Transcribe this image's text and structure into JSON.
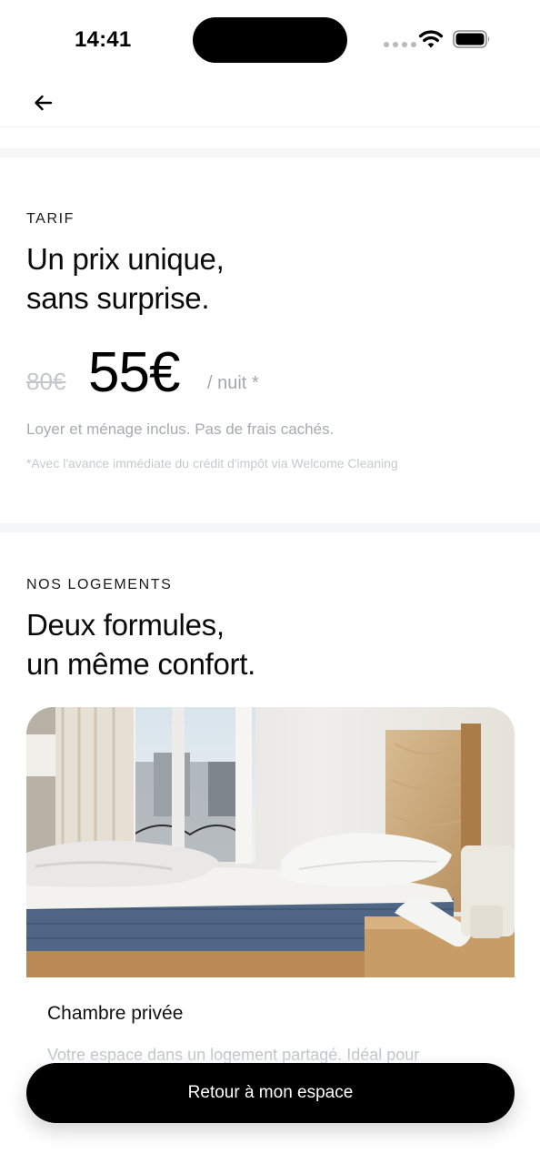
{
  "status_bar": {
    "time": "14:41"
  },
  "nav": {
    "back_icon": "arrow-left-icon"
  },
  "pricing": {
    "eyebrow": "TARIF",
    "headline_line1": "Un prix unique,",
    "headline_line2": "sans surprise.",
    "old_price": "80€",
    "new_price": "55€",
    "unit": "/ nuit *",
    "note": "Loyer et ménage inclus. Pas de frais cachés.",
    "footnote": "*Avec l'avance immédiate du crédit d'impôt via Welcome Cleaning"
  },
  "housing": {
    "eyebrow": "NOS LOGEMENTS",
    "headline_line1": "Deux formules,",
    "headline_line2": "un même confort.",
    "card": {
      "title": "Chambre privée",
      "description": "Votre espace dans un logement partagé. Idéal pour"
    }
  },
  "cta": {
    "label": "Retour à mon espace"
  },
  "colors": {
    "accent": "#000000",
    "muted": "#a6aab1",
    "band": "#f6f7f9"
  }
}
